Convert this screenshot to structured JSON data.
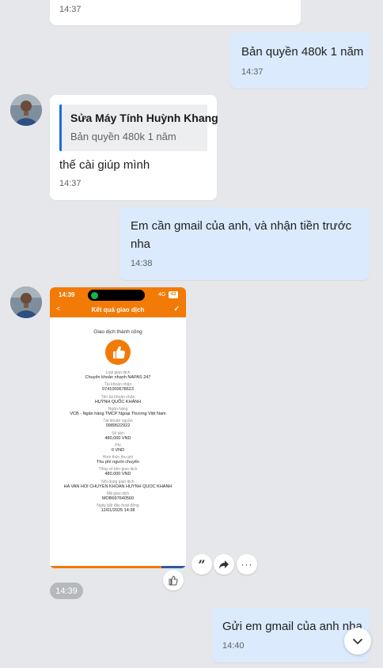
{
  "messages": [
    {
      "id": "m0",
      "direction": "in",
      "time": "14:37"
    },
    {
      "id": "m1",
      "direction": "out",
      "text": "Bản quyền 480k 1 năm",
      "time": "14:37"
    },
    {
      "id": "m2",
      "direction": "in",
      "quote": {
        "sender": "Sửa Máy Tính Huỳnh Khang",
        "text": "Bản quyền 480k 1 năm"
      },
      "text": "thế cài giúp mình",
      "time": "14:37"
    },
    {
      "id": "m3",
      "direction": "out",
      "text_line1": "Em cần gmail của anh, và nhận tiền trước",
      "text_line2": "nha",
      "time": "14:38"
    },
    {
      "id": "m4",
      "direction": "in",
      "type": "image",
      "time": "14:39"
    },
    {
      "id": "m5",
      "direction": "out",
      "text": "Gửi em gmail của anh nha",
      "time": "14:40"
    }
  ],
  "receipt": {
    "status_time": "14:39",
    "network": "4G",
    "battery": "43",
    "header_title": "Kết quả giao dịch",
    "success_text": "Giao dịch thành công",
    "fields": [
      {
        "label": "Loại giao dịch",
        "value": "Chuyển khoản nhanh NAPAS 247"
      },
      {
        "label": "Tài khoản nhận",
        "value": "0741000678623"
      },
      {
        "label": "Tên tài khoản nhận",
        "value": "HUỲNH QUỐC KHÁNH"
      },
      {
        "label": "Ngân hàng",
        "value": "VCB - Ngân hàng TMCP Ngoại Thương Việt Nam"
      },
      {
        "label": "Tài khoản nguồn",
        "value": "0989522922"
      },
      {
        "label": "Số tiền",
        "value": "480,000 VND"
      },
      {
        "label": "Phí",
        "value": "0 VND"
      },
      {
        "label": "Hình thức thu phí",
        "value": "Thu phí người chuyển"
      },
      {
        "label": "Tổng số tiền giao dịch",
        "value": "480,000 VND"
      },
      {
        "label": "Nội dung giao dịch",
        "value": "HA VAN HOI CHUYEN KHOAN HUYNH QUOC KHANH"
      },
      {
        "label": "Mã giao dịch",
        "value": "MOB697640560"
      },
      {
        "label": "Ngày bắt đầu hoạt động",
        "value": "12/01/2025 14:38"
      }
    ]
  },
  "image_actions": {
    "quote_icon": "quote-icon",
    "share_icon": "share-arrow-icon",
    "more_icon": "more-icon",
    "react_icon": "thumbs-up-icon"
  },
  "scroll_icon": "chevron-down-icon",
  "colors": {
    "outgoing_bubble": "#dbeafc",
    "incoming_bubble": "#ffffff",
    "background": "#e5e7ea",
    "quote_bar": "#1f6cd6",
    "receipt_orange": "#f27a07"
  }
}
